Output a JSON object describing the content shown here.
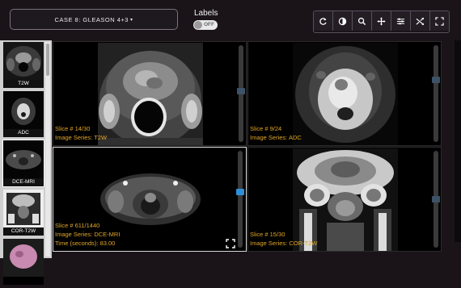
{
  "header": {
    "case_label": "CASE 8: GLEASON 4+3",
    "labels_title": "Labels",
    "labels_toggle": "OFF"
  },
  "toolbar": {
    "tools": [
      "reset-icon",
      "contrast-icon",
      "zoom-icon",
      "pan-icon",
      "adjust-icon",
      "shuffle-icon",
      "fullscreen-icon"
    ]
  },
  "thumbnails": [
    {
      "label": "T2W"
    },
    {
      "label": "ADC"
    },
    {
      "label": "DCE-MRI"
    },
    {
      "label": "COR-T2W"
    },
    {
      "label": ""
    }
  ],
  "viewers": [
    {
      "slice": "Slice # 14/30",
      "series": "Image Series: T2W",
      "slice_fraction": 0.47
    },
    {
      "slice": "Slice # 9/24",
      "series": "Image Series: ADC",
      "slice_fraction": 0.35
    },
    {
      "slice": "Slice # 611/1440",
      "series": "Image Series: DCE-MRI",
      "time": "Time (seconds): 83.00",
      "slice_fraction": 0.42
    },
    {
      "slice": "Slice # 15/30",
      "series": "Image Series: COR-T2W",
      "slice_fraction": 0.5
    }
  ],
  "colors": {
    "accent": "#e0a627",
    "active_handle": "#2e8fd6",
    "background": "#1a1419"
  }
}
